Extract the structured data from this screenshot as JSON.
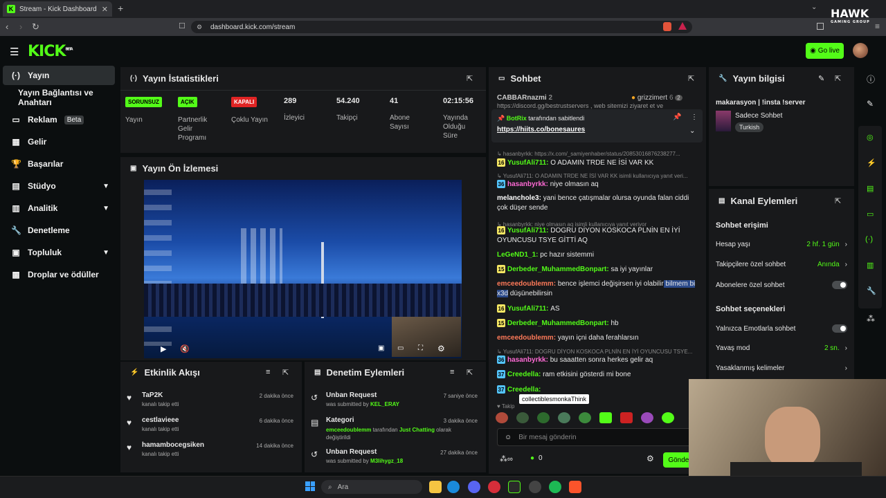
{
  "browser": {
    "tab_title": "Stream - Kick Dashboard",
    "url": "dashboard.kick.com/stream"
  },
  "header": {
    "logo": "KICK",
    "logo_sup": "BETA",
    "go_live": "Go live"
  },
  "sidebar": {
    "items": [
      {
        "label": "Yayın",
        "icon": "broadcast-icon"
      },
      {
        "label": "Yayın Bağlantısı ve Anahtarı"
      },
      {
        "label": "Reklam",
        "badge": "Beta",
        "icon": "ad-icon"
      },
      {
        "label": "Gelir",
        "icon": "revenue-icon"
      },
      {
        "label": "Başarılar",
        "icon": "trophy-icon"
      },
      {
        "label": "Stüdyo",
        "icon": "studio-icon"
      },
      {
        "label": "Analitik",
        "icon": "analytics-icon"
      },
      {
        "label": "Denetleme",
        "icon": "wrench-icon"
      },
      {
        "label": "Topluluk",
        "icon": "community-icon"
      },
      {
        "label": "Droplar ve ödüller",
        "icon": "drops-icon"
      }
    ]
  },
  "stats": {
    "title": "Yayın İstatistikleri",
    "unlimited": {
      "badge": "SORUNSUZ",
      "label": "Yayın"
    },
    "partner": {
      "badge": "AÇIK",
      "label": "Partnerlik Gelir Programı"
    },
    "multi": {
      "badge": "KAPALI",
      "label": "Çoklu Yayın"
    },
    "viewers": {
      "value": "289",
      "label": "İzleyici"
    },
    "followers": {
      "value": "54.240",
      "label": "Takipçi"
    },
    "subs": {
      "value": "41",
      "label": "Abone Sayısı"
    },
    "uptime": {
      "value": "02:15:56",
      "label": "Yayında Olduğu Süre"
    }
  },
  "preview": {
    "title": "Yayın Ön İzlemesi"
  },
  "activity": {
    "title": "Etkinlik Akışı",
    "items": [
      {
        "name": "TaP2K",
        "sub": "kanalı takip etti",
        "time": "2 dakika önce"
      },
      {
        "name": "cestlavieee",
        "sub": "kanalı takip etti",
        "time": "6 dakika önce"
      },
      {
        "name": "hamambocegsiken",
        "sub": "kanalı takip etti",
        "time": "14 dakika önce"
      }
    ]
  },
  "mod": {
    "title": "Denetim Eylemleri",
    "items": [
      {
        "name": "Unban Request",
        "pre": "was submitted by ",
        "user": "KEL_ERAY",
        "time": "7 saniye önce"
      },
      {
        "name": "Kategori",
        "pre": "",
        "user": "emceedoublemm",
        "mid": " tarafından ",
        "cat": "Just Chatting",
        "post": " olarak değiştirildi",
        "time": "3 dakika önce"
      },
      {
        "name": "Unban Request",
        "pre": "was submitted by ",
        "user": "M3lihygz_18",
        "time": "27 dakika önce"
      }
    ]
  },
  "chat": {
    "title": "Sohbet",
    "top_user": "CABBARnazmi",
    "top_count": "2",
    "top_right": "grizzimert",
    "top_right_count": "6",
    "top_right_badge": "2",
    "bg_url": "https://discord.gg/bestrustservers , web sitemizi ziyaret et ve",
    "pinned_by": "BotRix",
    "pinned_text": "tarafından sabitlendi",
    "pinned_link": "https://hiits.co/bonesaures",
    "lines": [
      {
        "reply": "hasanbyrkk: https://x.com/_samiyenhaber/status/20853016876238277..."
      },
      {
        "lvl": "16",
        "user": "YusufAli711",
        "msg": "O ADAMIN TRDE NE İSİ VAR KK"
      },
      {
        "reply": "YusufAli711: O ADAMIN TRDE NE İSİ VAR KK isimli kullanıcıya yanıt veri..."
      },
      {
        "lvl": "36",
        "user": "hasanbyrkk",
        "msg": "niye olmasın aq"
      },
      {
        "user": "melanchole3",
        "msg": "yani bence çatışmalar olursa oyunda falan ciddi çok düşer sende"
      },
      {
        "reply": "hasanbyrkk: niye olmasın aq isimli kullanıcıya yanıt veriyor"
      },
      {
        "lvl": "16",
        "user": "YusufAli711",
        "msg": "DOGRU DİYON KOSKOCA PLNİN EN İYİ OYUNCUSU TSYE GİTTİ AQ"
      },
      {
        "user": "LeGeND1_1",
        "msg": "pc hazır sistemmi"
      },
      {
        "lvl": "15",
        "user": "Derbeder_MuhammedBonpart",
        "msg": "sa iyi yayınlar"
      },
      {
        "user": "emceedoublemm",
        "msg": "bence işlemci değişirsen iyi olabilir",
        "hl": "bilmem bi x3d",
        "msg2": " düşünebilirsin"
      },
      {
        "lvl": "16",
        "user": "YusufAli711",
        "msg": "AS"
      },
      {
        "lvl": "15",
        "user": "Derbeder_MuhammedBonpart",
        "msg": "hb"
      },
      {
        "user": "emceedoublemm",
        "msg": "yayın içni daha ferahlarsın"
      },
      {
        "reply": "YusufAli711: DOGRU DİYON KOSKOCA PLNİN EN İYİ OYUNCUSU TSYE..."
      },
      {
        "lvl": "36",
        "user": "hasanbyrkk",
        "msg": "bu saaatten sonra herkes gelir aq"
      },
      {
        "lvl": "37",
        "user": "Creedella",
        "msg": "ram etkisini gösterdi mi bone"
      },
      {
        "lvl": "37",
        "user": "Creedella",
        "msg": ""
      }
    ],
    "tooltip": "collectiblesmonkaThink",
    "followers_label": "Takip",
    "placeholder": "Bir mesaj gönderin",
    "points": "0",
    "send": "Gönder"
  },
  "info": {
    "title": "Yayın bilgisi",
    "stream_title": "makarasyon | !insta !server",
    "category": "Sadece Sohbet",
    "tag": "Turkish"
  },
  "actions": {
    "title": "Kanal Eylemleri",
    "access_title": "Sohbet erişimi",
    "account_age": {
      "label": "Hesap yaşı",
      "value": "2 hf. 1 gün"
    },
    "followers_only": {
      "label": "Takipçilere özel sohbet",
      "value": "Anında"
    },
    "subs_only": {
      "label": "Abonelere özel sohbet"
    },
    "options_title": "Sohbet seçenekleri",
    "emote_only": {
      "label": "Yalnızca Emotlarla sohbet"
    },
    "slow": {
      "label": "Yavaş mod",
      "value": "2 sn."
    },
    "banned": {
      "label": "Yasaklanmış kelimeler"
    }
  },
  "overlay": {
    "brand": "HAWK",
    "brand_sub": "GAMING GROUP"
  },
  "taskbar": {
    "search": "Ara"
  }
}
